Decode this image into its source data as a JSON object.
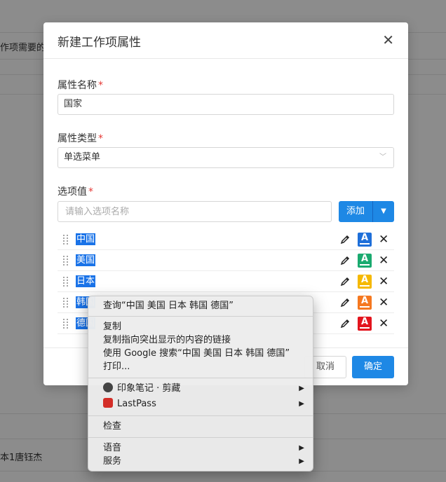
{
  "background": {
    "snippet_top": "作项需要的",
    "snippet_bottom": "本1唐钰杰"
  },
  "modal": {
    "title": "新建工作项属性",
    "close_icon": "close-icon",
    "name_label": "属性名称",
    "name_value": "国家",
    "type_label": "属性类型",
    "type_value": "单选菜单",
    "options_label": "选项值",
    "options_placeholder": "请输入选项名称",
    "add_label": "添加",
    "required_mark": "*",
    "options": [
      {
        "label": "中国",
        "color": "#1e6fd9"
      },
      {
        "label": "美国",
        "color": "#1aaa6f"
      },
      {
        "label": "日本",
        "color": "#f5b800"
      },
      {
        "label": "韩国",
        "color": "#f5781f"
      },
      {
        "label": "德国",
        "color": "#e3141d"
      }
    ],
    "cancel_label": "取消",
    "ok_label": "确定",
    "accent_color": "#1e88e5"
  },
  "context_menu": {
    "lookup": "查询“中国 美国 日本 韩国 德国”",
    "copy": "复制",
    "copy_link": "复制指向突出显示的内容的链接",
    "google_search": "使用 Google 搜索“中国 美国 日本 韩国 德国”",
    "print": "打印...",
    "evernote": "印象笔记 · 剪藏",
    "lastpass": "LastPass",
    "inspect": "检查",
    "speech": "语音",
    "services": "服务"
  }
}
